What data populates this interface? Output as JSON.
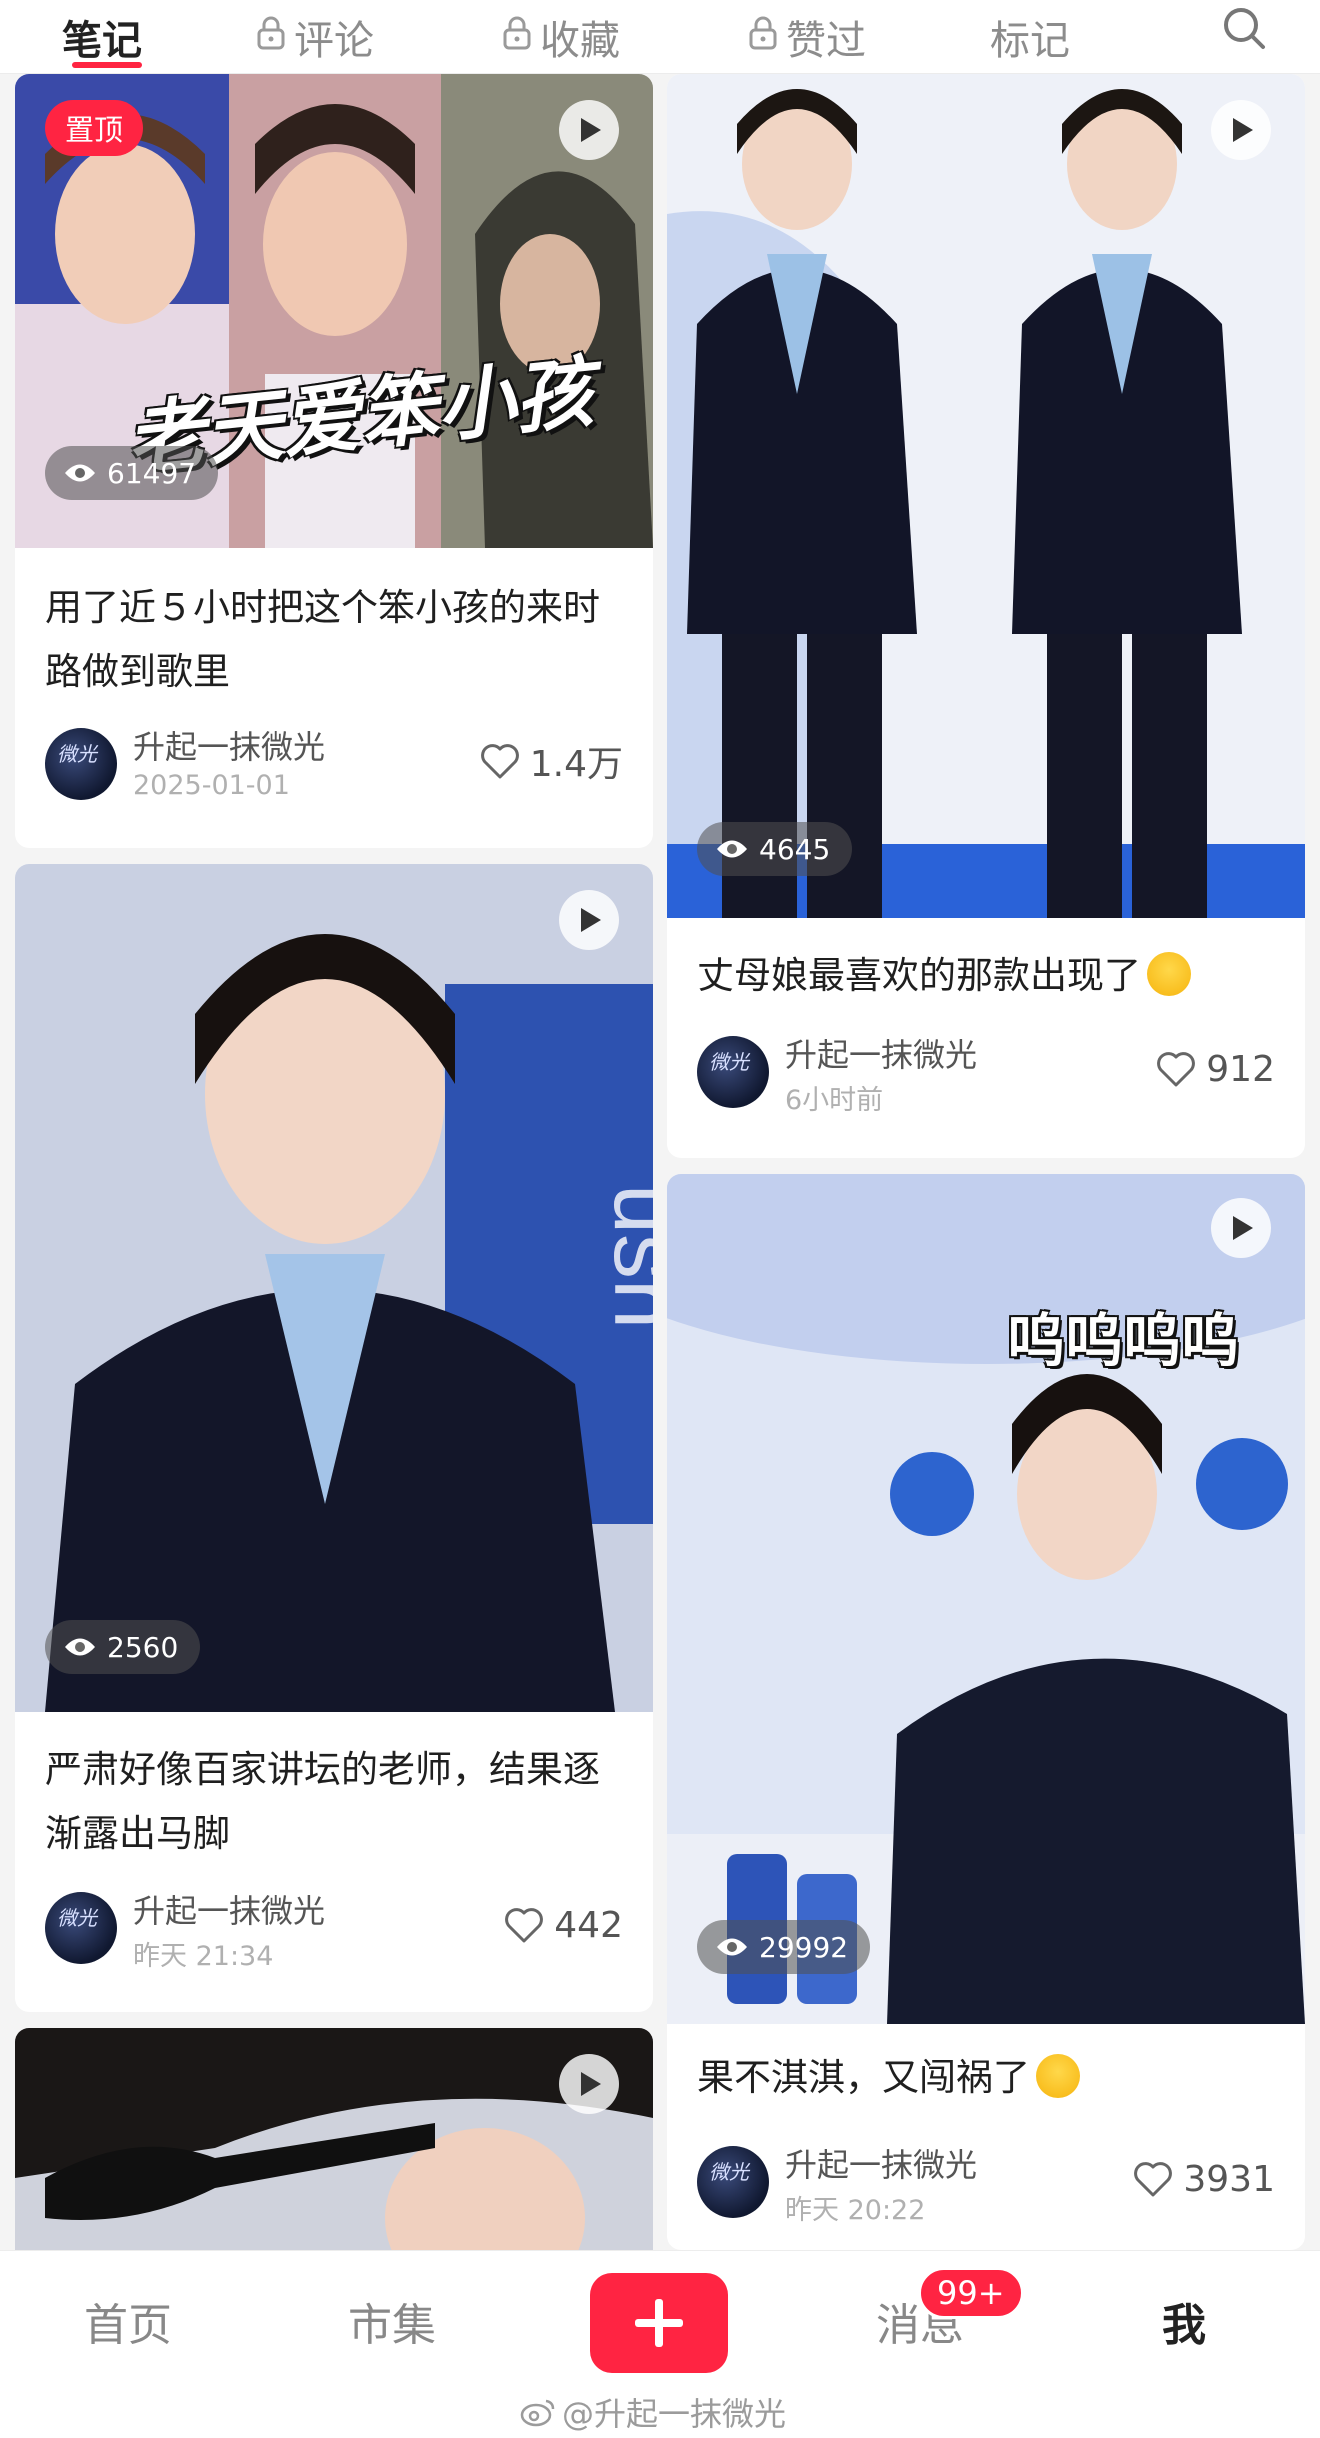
{
  "tabs": [
    {
      "label": "笔记",
      "locked": false,
      "active": true
    },
    {
      "label": "评论",
      "locked": true,
      "active": false
    },
    {
      "label": "收藏",
      "locked": true,
      "active": false
    },
    {
      "label": "赞过",
      "locked": true,
      "active": false
    },
    {
      "label": "标记",
      "locked": false,
      "active": false
    }
  ],
  "search_icon": "search-icon",
  "notes": [
    {
      "pinned_label": "置顶",
      "overlay_text": "老天爱笨小孩",
      "views": "61497",
      "title": "用了近５小时把这个笨小孩的来时路做到歌里",
      "author": "升起一抹微光",
      "date": "2025-01-01",
      "likes": "1.4万"
    },
    {
      "views": "4645",
      "title": "丈母娘最喜欢的那款出现了",
      "title_emoji": "hand-over-mouth-emoji",
      "author": "升起一抹微光",
      "date": "6小时前",
      "likes": "912"
    },
    {
      "views": "2560",
      "title": "严肃好像百家讲坛的老师，结果逐渐露出马脚",
      "author": "升起一抹微光",
      "date": "昨天 21:34",
      "likes": "442"
    },
    {
      "views": "29992",
      "title": "果不淇淇，又闯祸了",
      "title_emoji": "sweat-smile-emoji",
      "author": "升起一抹微光",
      "date": "昨天 20:22",
      "likes": "3931"
    },
    {}
  ],
  "bottom_nav": {
    "home": "首页",
    "market": "市集",
    "messages": "消息",
    "messages_badge": "99+",
    "me": "我"
  },
  "watermark": "@升起一抹微光",
  "colors": {
    "accent": "#ff2442"
  }
}
